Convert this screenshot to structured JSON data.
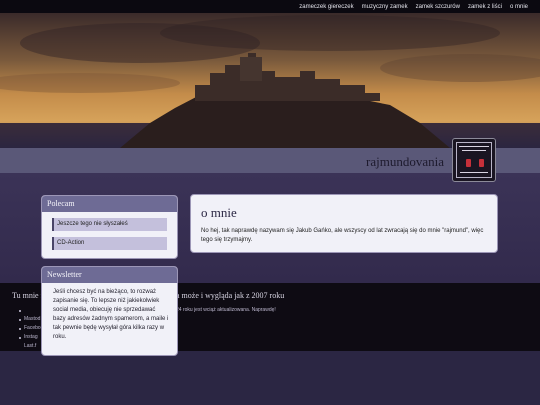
{
  "nav": {
    "items": [
      "zameczek giereczek",
      "muzyczny zamek",
      "zamek szczurów",
      "zamek z liści",
      "o mnie"
    ]
  },
  "site": {
    "title": "rajmundovania"
  },
  "sidebar": {
    "polecam": {
      "title": "Polecam",
      "items": [
        "Jeszcze tego nie słyszałeś",
        "CD-Action"
      ]
    },
    "newsletter": {
      "title": "Newsletter",
      "text": "Jeśli chcesz być na bieżąco, to rozważ zapisanie się. To lepsze niż jakiekolwiek social media, obiecuję nie sprzedawać bazy adresów żadnym spamerom, a maile i tak pewnie będę wysyłał góra kilka razy w roku."
    }
  },
  "main": {
    "title": "o mnie",
    "text": "No hej, tak naprawdę nazywam się Jakub Gańko, ale wszyscy od lat zwracają się do mnie \"rajmund\", więc tego się trzymajmy."
  },
  "footer": {
    "heading_start": "Tu mnie m",
    "heading_end": "a może i wygląda jak z 2007 roku",
    "links": [
      "Mastod",
      "Facebo",
      "Instag",
      "Last.f"
    ],
    "note": "24 roku jest wciąż aktualizowana. Naprawdę!"
  },
  "colors": {
    "topbar": "#0b0910",
    "panel_header": "#6e6b95",
    "panel_bg": "#f1f1f8",
    "strip": "#5a5878",
    "page_bg": "#2d2748"
  }
}
